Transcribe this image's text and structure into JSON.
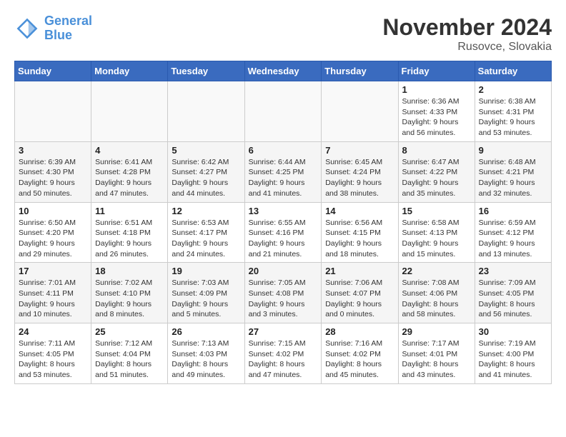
{
  "header": {
    "logo_line1": "General",
    "logo_line2": "Blue",
    "month_title": "November 2024",
    "location": "Rusovce, Slovakia"
  },
  "weekdays": [
    "Sunday",
    "Monday",
    "Tuesday",
    "Wednesday",
    "Thursday",
    "Friday",
    "Saturday"
  ],
  "weeks": [
    [
      {
        "day": "",
        "info": ""
      },
      {
        "day": "",
        "info": ""
      },
      {
        "day": "",
        "info": ""
      },
      {
        "day": "",
        "info": ""
      },
      {
        "day": "",
        "info": ""
      },
      {
        "day": "1",
        "info": "Sunrise: 6:36 AM\nSunset: 4:33 PM\nDaylight: 9 hours and 56 minutes."
      },
      {
        "day": "2",
        "info": "Sunrise: 6:38 AM\nSunset: 4:31 PM\nDaylight: 9 hours and 53 minutes."
      }
    ],
    [
      {
        "day": "3",
        "info": "Sunrise: 6:39 AM\nSunset: 4:30 PM\nDaylight: 9 hours and 50 minutes."
      },
      {
        "day": "4",
        "info": "Sunrise: 6:41 AM\nSunset: 4:28 PM\nDaylight: 9 hours and 47 minutes."
      },
      {
        "day": "5",
        "info": "Sunrise: 6:42 AM\nSunset: 4:27 PM\nDaylight: 9 hours and 44 minutes."
      },
      {
        "day": "6",
        "info": "Sunrise: 6:44 AM\nSunset: 4:25 PM\nDaylight: 9 hours and 41 minutes."
      },
      {
        "day": "7",
        "info": "Sunrise: 6:45 AM\nSunset: 4:24 PM\nDaylight: 9 hours and 38 minutes."
      },
      {
        "day": "8",
        "info": "Sunrise: 6:47 AM\nSunset: 4:22 PM\nDaylight: 9 hours and 35 minutes."
      },
      {
        "day": "9",
        "info": "Sunrise: 6:48 AM\nSunset: 4:21 PM\nDaylight: 9 hours and 32 minutes."
      }
    ],
    [
      {
        "day": "10",
        "info": "Sunrise: 6:50 AM\nSunset: 4:20 PM\nDaylight: 9 hours and 29 minutes."
      },
      {
        "day": "11",
        "info": "Sunrise: 6:51 AM\nSunset: 4:18 PM\nDaylight: 9 hours and 26 minutes."
      },
      {
        "day": "12",
        "info": "Sunrise: 6:53 AM\nSunset: 4:17 PM\nDaylight: 9 hours and 24 minutes."
      },
      {
        "day": "13",
        "info": "Sunrise: 6:55 AM\nSunset: 4:16 PM\nDaylight: 9 hours and 21 minutes."
      },
      {
        "day": "14",
        "info": "Sunrise: 6:56 AM\nSunset: 4:15 PM\nDaylight: 9 hours and 18 minutes."
      },
      {
        "day": "15",
        "info": "Sunrise: 6:58 AM\nSunset: 4:13 PM\nDaylight: 9 hours and 15 minutes."
      },
      {
        "day": "16",
        "info": "Sunrise: 6:59 AM\nSunset: 4:12 PM\nDaylight: 9 hours and 13 minutes."
      }
    ],
    [
      {
        "day": "17",
        "info": "Sunrise: 7:01 AM\nSunset: 4:11 PM\nDaylight: 9 hours and 10 minutes."
      },
      {
        "day": "18",
        "info": "Sunrise: 7:02 AM\nSunset: 4:10 PM\nDaylight: 9 hours and 8 minutes."
      },
      {
        "day": "19",
        "info": "Sunrise: 7:03 AM\nSunset: 4:09 PM\nDaylight: 9 hours and 5 minutes."
      },
      {
        "day": "20",
        "info": "Sunrise: 7:05 AM\nSunset: 4:08 PM\nDaylight: 9 hours and 3 minutes."
      },
      {
        "day": "21",
        "info": "Sunrise: 7:06 AM\nSunset: 4:07 PM\nDaylight: 9 hours and 0 minutes."
      },
      {
        "day": "22",
        "info": "Sunrise: 7:08 AM\nSunset: 4:06 PM\nDaylight: 8 hours and 58 minutes."
      },
      {
        "day": "23",
        "info": "Sunrise: 7:09 AM\nSunset: 4:05 PM\nDaylight: 8 hours and 56 minutes."
      }
    ],
    [
      {
        "day": "24",
        "info": "Sunrise: 7:11 AM\nSunset: 4:05 PM\nDaylight: 8 hours and 53 minutes."
      },
      {
        "day": "25",
        "info": "Sunrise: 7:12 AM\nSunset: 4:04 PM\nDaylight: 8 hours and 51 minutes."
      },
      {
        "day": "26",
        "info": "Sunrise: 7:13 AM\nSunset: 4:03 PM\nDaylight: 8 hours and 49 minutes."
      },
      {
        "day": "27",
        "info": "Sunrise: 7:15 AM\nSunset: 4:02 PM\nDaylight: 8 hours and 47 minutes."
      },
      {
        "day": "28",
        "info": "Sunrise: 7:16 AM\nSunset: 4:02 PM\nDaylight: 8 hours and 45 minutes."
      },
      {
        "day": "29",
        "info": "Sunrise: 7:17 AM\nSunset: 4:01 PM\nDaylight: 8 hours and 43 minutes."
      },
      {
        "day": "30",
        "info": "Sunrise: 7:19 AM\nSunset: 4:00 PM\nDaylight: 8 hours and 41 minutes."
      }
    ]
  ]
}
